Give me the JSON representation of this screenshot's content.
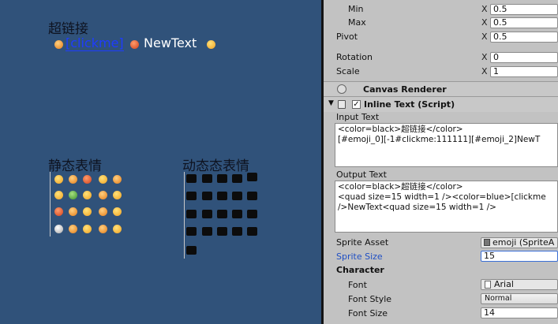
{
  "scene": {
    "hyperlink_title": "超链接",
    "hyperlink_text": "[clickme]",
    "newtext": "NewText",
    "static_title": "静态表情",
    "dynamic_title": "动态态表情"
  },
  "inspector": {
    "rows": {
      "min_label": "Min",
      "max_label": "Max",
      "pivot_label": "Pivot",
      "rotation_label": "Rotation",
      "scale_label": "Scale",
      "axis_x": "X",
      "min_x": "0.5",
      "max_x": "0.5",
      "pivot_x": "0.5",
      "rotation_x": "0",
      "scale_x": "1"
    },
    "canvas_renderer_label": "Canvas Renderer",
    "inline_text_label": "Inline Text (Script)",
    "input_text_label": "Input Text",
    "input_text_line1": "<color=black>超链接</color>",
    "input_text_line2": "[#emoji_0][-1#clickme:111111][#emoji_2]NewT",
    "output_text_label": "Output Text",
    "output_text_line1": "<color=black>超链接</color>",
    "output_text_line2": "<quad size=15 width=1 /><color=blue>[clickme",
    "output_text_line3": "/>NewText<quad size=15 width=1 />",
    "sprite_asset_label": "Sprite Asset",
    "sprite_asset_value": "emoji (SpriteA",
    "sprite_size_label": "Sprite Size",
    "sprite_size_value": "15",
    "character_label": "Character",
    "font_label": "Font",
    "font_value": "Arial",
    "font_style_label": "Font Style",
    "font_style_value": "Normal",
    "font_size_label": "Font Size",
    "font_size_value": "14"
  },
  "colors": {
    "scene_bg": "#30527a",
    "link_blue": "#1e3cff",
    "inspector_bg": "#c2c2c2",
    "sprite_size_blue": "#1f4fc4"
  }
}
